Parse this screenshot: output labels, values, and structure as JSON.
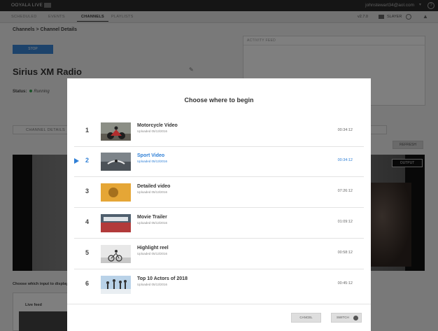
{
  "topbar": {
    "brand": "OOYALA LIVE",
    "user": "johnstewart34@aol.com",
    "caret": "▾",
    "help": "?"
  },
  "nav": {
    "tabs": [
      "SCHEDULED",
      "EVENTS",
      "CHANNELS",
      "PLAYLISTS"
    ],
    "active_tab": "CHANNELS",
    "version": "v2.7.0",
    "player_label": "SLAYER"
  },
  "page": {
    "breadcrumb": "Channels > Channel Details",
    "stop_label": "STOP",
    "channel_name": "Sirius XM Radio",
    "status_label": "Status:",
    "status_value": "Running",
    "activity_title": "ACTIVITY FEED",
    "tab_details": "CHANNEL DETAILS",
    "refresh_label": "REFRESH",
    "output_label": "OUTPUT",
    "choose_input": "Choose which input to display",
    "live_feed": "Live feed"
  },
  "modal": {
    "title": "Choose where to begin",
    "rows": [
      {
        "num": "1",
        "title": "Motorcycle Video",
        "sub": "Uploaded 05/13/2016",
        "dur": "00:34:12",
        "selected": false
      },
      {
        "num": "2",
        "title": "Sport Video",
        "sub": "Uploaded 05/13/2016",
        "dur": "00:34:12",
        "selected": true
      },
      {
        "num": "3",
        "title": "Detailed video",
        "sub": "Uploaded 05/13/2016",
        "dur": "07:26:12",
        "selected": false
      },
      {
        "num": "4",
        "title": "Movie Trailer",
        "sub": "Uploaded 05/13/2016",
        "dur": "01:09:12",
        "selected": false
      },
      {
        "num": "5",
        "title": "Highlight reel",
        "sub": "Uploaded 05/13/2016",
        "dur": "00:58:12",
        "selected": false
      },
      {
        "num": "6",
        "title": "Top 10 Actors of 2018",
        "sub": "Uploaded 05/13/2016",
        "dur": "00:45:12",
        "selected": false
      }
    ],
    "cancel_label": "CANCEL",
    "switch_label": "SWITCH"
  },
  "colors": {
    "accent": "#2e7fd6",
    "status_running": "#3aa655"
  }
}
